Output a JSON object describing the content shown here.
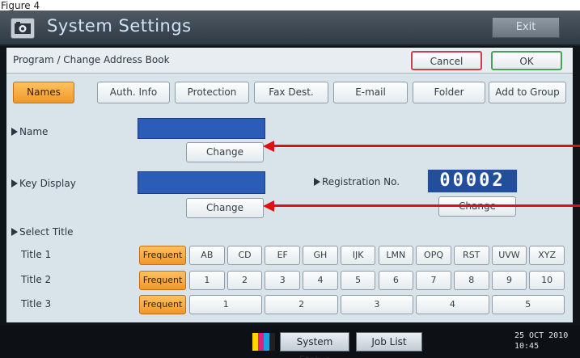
{
  "figure_label": "Figure 4",
  "titlebar": {
    "title": "System Settings",
    "exit_label": "Exit"
  },
  "subheader": {
    "title": "Program / Change Address Book",
    "cancel_label": "Cancel",
    "ok_label": "OK"
  },
  "tabs": [
    {
      "label": "Names",
      "active": true
    },
    {
      "label": "Auth. Info",
      "active": false
    },
    {
      "label": "Protection",
      "active": false
    },
    {
      "label": "Fax Dest.",
      "active": false
    },
    {
      "label": "E-mail",
      "active": false
    },
    {
      "label": "Folder",
      "active": false
    },
    {
      "label": "Add to Group",
      "active": false
    }
  ],
  "fields": {
    "name_label": "Name",
    "name_change": "Change",
    "key_display_label": "Key Display",
    "key_display_change": "Change",
    "registration_label": "Registration No.",
    "registration_value": "00002",
    "registration_change": "Change"
  },
  "select_title": {
    "label": "Select Title",
    "rows": [
      {
        "label": "Title 1",
        "frequent": "Frequent",
        "options": [
          "AB",
          "CD",
          "EF",
          "GH",
          "IJK",
          "LMN",
          "OPQ",
          "RST",
          "UVW",
          "XYZ"
        ]
      },
      {
        "label": "Title 2",
        "frequent": "Frequent",
        "options": [
          "1",
          "2",
          "3",
          "4",
          "5",
          "6",
          "7",
          "8",
          "9",
          "10"
        ]
      },
      {
        "label": "Title 3",
        "frequent": "Frequent",
        "options": [
          "1",
          "2",
          "3",
          "4",
          "5"
        ]
      }
    ]
  },
  "bottombar": {
    "system_status": "System Status",
    "job_list": "Job List",
    "date": "25 OCT  2010",
    "time": "10:45",
    "cmyk_colors": [
      "#ffd400",
      "#e0208a",
      "#1aa0e0",
      "#202020"
    ]
  },
  "accent_colors": {
    "active_tab": "#f0982a",
    "field_blue": "#2a5cb8",
    "arrow_red": "#e01010",
    "cancel_border": "#c9404c",
    "ok_border": "#4aa05b"
  }
}
